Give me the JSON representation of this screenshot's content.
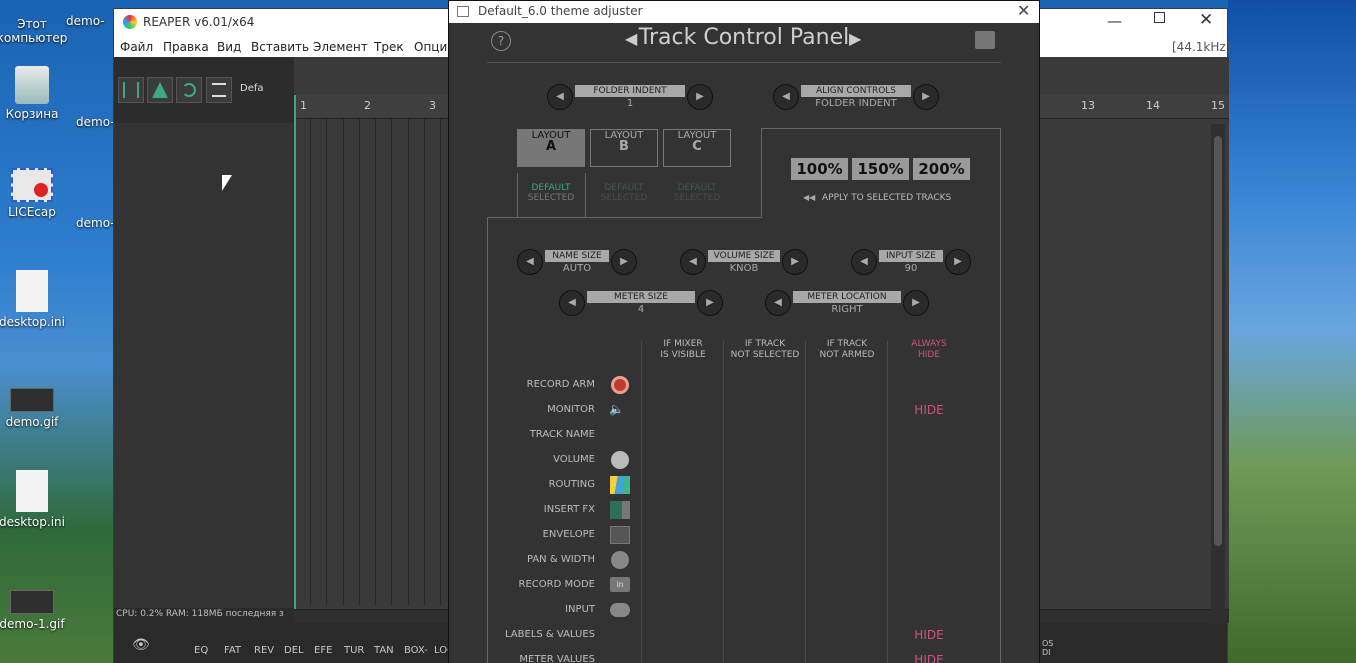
{
  "desktop": {
    "icons": [
      {
        "label": "Этот компьютер",
        "icon": "computer-icon"
      },
      {
        "label": "Корзина",
        "icon": "recycle-bin-icon"
      },
      {
        "label": "LICEcap",
        "icon": "licecap-icon"
      },
      {
        "label": "desktop.ini",
        "icon": "ini-file-icon"
      },
      {
        "label": "demo.gif",
        "icon": "gif-file-icon"
      },
      {
        "label": "desktop.ini",
        "icon": "ini-file-icon"
      },
      {
        "label": "demo-1.gif",
        "icon": "gif-file-icon"
      }
    ],
    "column2": [
      "demo-",
      "demo-",
      "demo-"
    ]
  },
  "reaper": {
    "title": "REAPER v6.01/x64",
    "samplerate": "[44.1kHz]",
    "menu": [
      "Файл",
      "Правка",
      "Вид",
      "Вставить",
      "Элемент",
      "Трек",
      "Опци"
    ],
    "toolbar_label": "Defa",
    "ruler": [
      "1",
      "2",
      "3",
      "13",
      "14",
      "15"
    ],
    "status": "CPU: 0.2%  RAM: 118МБ  последняя з",
    "bottom_tabs": [
      "EQ",
      "FAT",
      "REV",
      "DEL",
      "EFE",
      "TUR",
      "TAN",
      "BOX-",
      "LOO"
    ],
    "bottom_right": "OS\nDI"
  },
  "adjuster": {
    "title": "Default_6.0 theme adjuster",
    "heading": "Track Control Panel",
    "folder_indent": {
      "label": "FOLDER INDENT",
      "value": "1"
    },
    "align_controls": {
      "label": "ALIGN CONTROLS",
      "value": "FOLDER INDENT"
    },
    "layouts": [
      {
        "top": "LAYOUT",
        "big": "A",
        "state_top": "DEFAULT",
        "state_bottom": "SELECTED"
      },
      {
        "top": "LAYOUT",
        "big": "B",
        "state_top": "DEFAULT",
        "state_bottom": "SELECTED"
      },
      {
        "top": "LAYOUT",
        "big": "C",
        "state_top": "DEFAULT",
        "state_bottom": "SELECTED"
      }
    ],
    "scales": [
      "100%",
      "150%",
      "200%"
    ],
    "apply_label": "APPLY TO SELECTED TRACKS",
    "name_size": {
      "label": "NAME SIZE",
      "value": "AUTO"
    },
    "volume_size": {
      "label": "VOLUME SIZE",
      "value": "KNOB"
    },
    "input_size": {
      "label": "INPUT SIZE",
      "value": "90"
    },
    "meter_size": {
      "label": "METER SIZE",
      "value": "4"
    },
    "meter_location": {
      "label": "METER LOCATION",
      "value": "RIGHT"
    },
    "columns": [
      {
        "l1": "IF MIXER",
        "l2": "IS VISIBLE"
      },
      {
        "l1": "IF TRACK",
        "l2": "NOT SELECTED"
      },
      {
        "l1": "IF TRACK",
        "l2": "NOT ARMED"
      },
      {
        "l1": "ALWAYS",
        "l2": "HIDE"
      }
    ],
    "rows": [
      {
        "label": "RECORD ARM",
        "icon": "record-arm-icon",
        "hide": ""
      },
      {
        "label": "MONITOR",
        "icon": "speaker-icon",
        "hide": "HIDE"
      },
      {
        "label": "TRACK NAME",
        "icon": "",
        "hide": ""
      },
      {
        "label": "VOLUME",
        "icon": "volume-knob-icon",
        "hide": ""
      },
      {
        "label": "ROUTING",
        "icon": "routing-icon",
        "hide": ""
      },
      {
        "label": "INSERT FX",
        "icon": "insert-fx-icon",
        "hide": ""
      },
      {
        "label": "ENVELOPE",
        "icon": "envelope-icon",
        "hide": ""
      },
      {
        "label": "PAN & WIDTH",
        "icon": "pan-knob-icon",
        "hide": ""
      },
      {
        "label": "RECORD MODE",
        "icon": "record-mode-icon",
        "hide": ""
      },
      {
        "label": "INPUT",
        "icon": "input-icon",
        "hide": ""
      },
      {
        "label": "LABELS & VALUES",
        "icon": "",
        "hide": "HIDE"
      },
      {
        "label": "METER VALUES",
        "icon": "",
        "hide": "HIDE"
      }
    ],
    "record_mode_glyph": "in",
    "colors": {
      "accent_green": "#3fa58a",
      "hide_pink": "#d25082",
      "record_red": "#c0392b"
    }
  }
}
